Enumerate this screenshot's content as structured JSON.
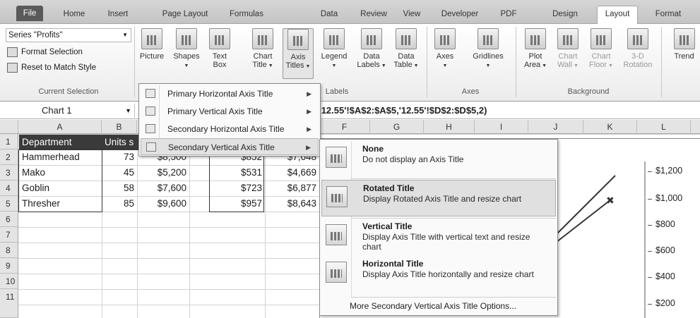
{
  "tabs": [
    "File",
    "Home",
    "Insert",
    "Page Layout",
    "Formulas",
    "Data",
    "Review",
    "View",
    "Developer",
    "PDF",
    "Design",
    "Layout",
    "Format"
  ],
  "ribbon": {
    "selection_combo": "Series \"Profits\"",
    "format_selection": "Format Selection",
    "reset_style": "Reset to Match Style",
    "current_selection_label": "Current Selection",
    "buttons": {
      "picture": "Picture",
      "shapes": "Shapes",
      "text_box_1": "Text",
      "text_box_2": "Box",
      "chart_title_1": "Chart",
      "chart_title_2": "Title",
      "axis_titles_1": "Axis",
      "axis_titles_2": "Titles",
      "legend": "Legend",
      "data_labels_1": "Data",
      "data_labels_2": "Labels",
      "data_table_1": "Data",
      "data_table_2": "Table",
      "axes": "Axes",
      "gridlines": "Gridlines",
      "plot_area_1": "Plot",
      "plot_area_2": "Area",
      "chart_wall_1": "Chart",
      "chart_wall_2": "Wall",
      "chart_floor_1": "Chart",
      "chart_floor_2": "Floor",
      "rotation_1": "3-D",
      "rotation_2": "Rotation",
      "trend": "Trend"
    },
    "group_labels": {
      "labels": "Labels",
      "axes": "Axes",
      "background": "Background"
    }
  },
  "formula_bar": {
    "name_box": "Chart 1",
    "formula": ",'12.55'!$A$2:$A$5,'12.55'!$D$2:$D$5,2)"
  },
  "columns": [
    "A",
    "B",
    "",
    "",
    "",
    "F",
    "G",
    "H",
    "I",
    "J",
    "K",
    "L"
  ],
  "rows": [
    "1",
    "2",
    "3",
    "4",
    "5",
    "6",
    "7",
    "8",
    "9",
    "10",
    "11"
  ],
  "sheet": {
    "header": [
      "Department",
      "Units s"
    ],
    "data": [
      [
        "Hammerhead",
        "73",
        "$8,500",
        "$852",
        "$7,648"
      ],
      [
        "Mako",
        "45",
        "$5,200",
        "$531",
        "$4,669"
      ],
      [
        "Goblin",
        "58",
        "$7,600",
        "$723",
        "$6,877"
      ],
      [
        "Thresher",
        "85",
        "$9,600",
        "$957",
        "$8,643"
      ]
    ]
  },
  "chart_axis": [
    "$1,200",
    "$1,000",
    "$800",
    "$600",
    "$400",
    "$200"
  ],
  "menu_axis_titles": [
    {
      "label": "Primary Horizontal Axis Title",
      "icon": "horizontal-axis-icon"
    },
    {
      "label": "Primary Vertical Axis Title",
      "icon": "vertical-axis-icon"
    },
    {
      "label": "Secondary Horizontal Axis Title",
      "icon": "secondary-horizontal-axis-icon"
    },
    {
      "label": "Secondary Vertical Axis Title",
      "icon": "secondary-vertical-axis-icon"
    }
  ],
  "menu_secondary_vertical": {
    "options": [
      {
        "title": "None",
        "desc": "Do not display an Axis Title"
      },
      {
        "title": "Rotated Title",
        "desc": "Display Rotated Axis Title and resize chart"
      },
      {
        "title": "Vertical Title",
        "desc": "Display Axis Title with vertical text and resize chart"
      },
      {
        "title": "Horizontal Title",
        "desc": "Display Axis Title horizontally and resize chart"
      }
    ],
    "more": "More Secondary Vertical Axis Title Options..."
  }
}
